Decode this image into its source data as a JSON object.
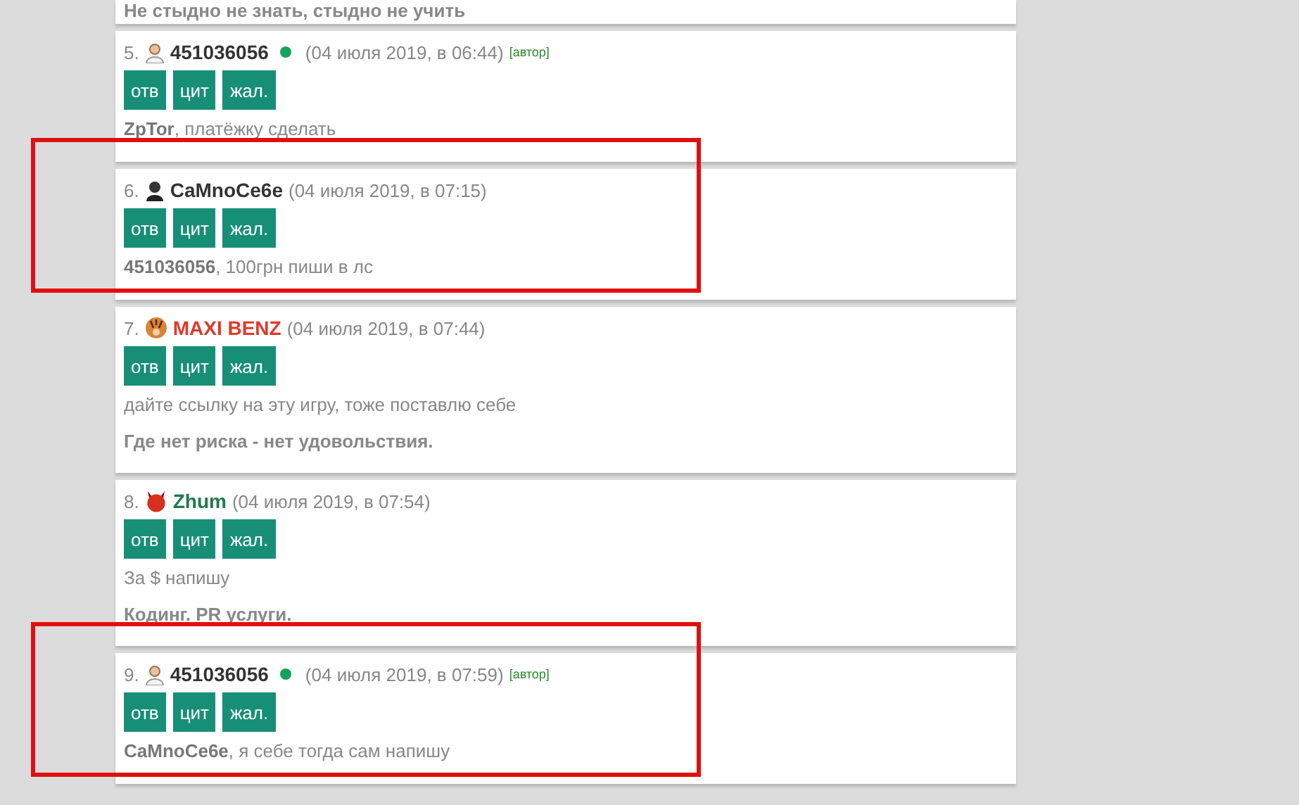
{
  "top_signature": "Не стыдно не знать, стыдно не учить",
  "posts": [
    {
      "number": "5.",
      "avatar": {
        "kind": "person"
      },
      "name": "451036056",
      "color": "#333333",
      "online": true,
      "date": "(04 июля 2019, в 06:44)",
      "author_tag": "[автор]",
      "buttons": [
        "отв",
        "цит",
        "жал."
      ],
      "message": "**ZpTor**, платёжку сделать",
      "highlighted": false
    },
    {
      "number": "6.",
      "avatar": {
        "kind": "dark-person"
      },
      "name": "CaMnoCe6e",
      "color": "#333333",
      "online": false,
      "date": "(04 июля 2019, в 07:15)",
      "buttons": [
        "отв",
        "цит",
        "жал."
      ],
      "message": "**451036056**, 100грн пиши в лс",
      "highlighted": true
    },
    {
      "number": "7.",
      "avatar": {
        "kind": "tiger"
      },
      "name": "MAXI BENZ",
      "color": "#e0392b",
      "online": false,
      "date": "(04 июля 2019, в 07:44)",
      "buttons": [
        "отв",
        "цит",
        "жал."
      ],
      "message": "дайте ссылку на эту игру, тоже поставлю себе",
      "signature": "Где нет риска - нет удовольствия.",
      "highlighted": false
    },
    {
      "number": "8.",
      "avatar": {
        "kind": "devil"
      },
      "name": "Zhum",
      "color": "#1f7a4a",
      "online": false,
      "date": "(04 июля 2019, в 07:54)",
      "buttons": [
        "отв",
        "цит",
        "жал."
      ],
      "message": "За $ напишу",
      "signature": "Кодинг. PR услуги.",
      "highlighted": false
    },
    {
      "number": "9.",
      "avatar": {
        "kind": "person"
      },
      "name": "451036056",
      "color": "#333333",
      "online": true,
      "date": "(04 июля 2019, в 07:59)",
      "author_tag": "[автор]",
      "buttons": [
        "отв",
        "цит",
        "жал."
      ],
      "message": "**CaMnoCe6e**, я себе тогда сам напишу",
      "highlighted": true
    }
  ]
}
